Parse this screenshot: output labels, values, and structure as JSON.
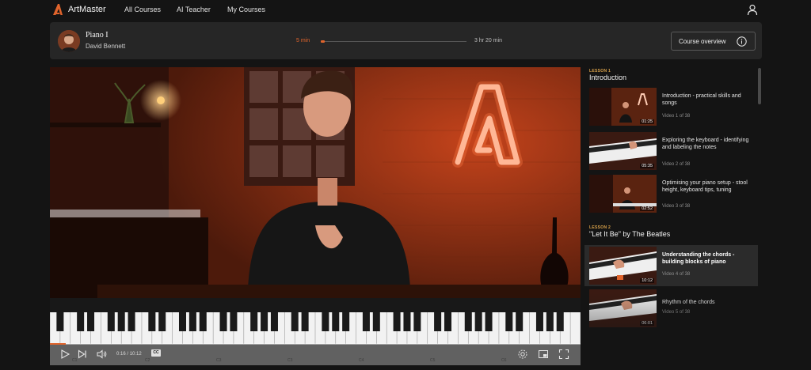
{
  "nav": {
    "brand": "ArtMaster",
    "links": [
      "All Courses",
      "AI Teacher",
      "My Courses"
    ],
    "user_icon": "user-icon"
  },
  "course": {
    "title": "Piano I",
    "instructor": "David Bennett",
    "progress_elapsed": "5 min",
    "progress_total": "3 hr 20 min",
    "progress_fraction": 0.025,
    "overview_button": "Course overview"
  },
  "player": {
    "time_current": "0:16",
    "time_total": "10:12",
    "cc_label": "CC",
    "progress_fraction": 0.03,
    "icons": [
      "play-icon",
      "skip-next-icon",
      "volume-icon",
      "settings-icon",
      "picture-in-picture-icon",
      "fullscreen-icon"
    ]
  },
  "lessons": [
    {
      "kicker": "LESSON 1",
      "title": "Introduction",
      "videos": [
        {
          "title": "Introduction - practical skills and songs",
          "count": "Video 1 of 38",
          "duration": "01:25",
          "active": false
        },
        {
          "title": "Exploring the keyboard - identifying and labeling the notes",
          "count": "Video 2 of 38",
          "duration": "05:35",
          "active": false
        },
        {
          "title": "Optimising your piano setup - stool height, keyboard tips, tuning",
          "count": "Video 3 of 38",
          "duration": "02:52",
          "active": false
        }
      ]
    },
    {
      "kicker": "LESSON 2",
      "title": "\"Let It Be\" by The Beatles",
      "videos": [
        {
          "title": "Understanding the chords - building blocks of piano",
          "count": "Video 4 of 38",
          "duration": "10:12",
          "active": true
        },
        {
          "title": "Rhythm of the chords",
          "count": "Video 5 of 38",
          "duration": "06:01",
          "active": false
        }
      ]
    }
  ],
  "colors": {
    "accent": "#e0642c",
    "background": "#141414",
    "panel": "#262626"
  }
}
